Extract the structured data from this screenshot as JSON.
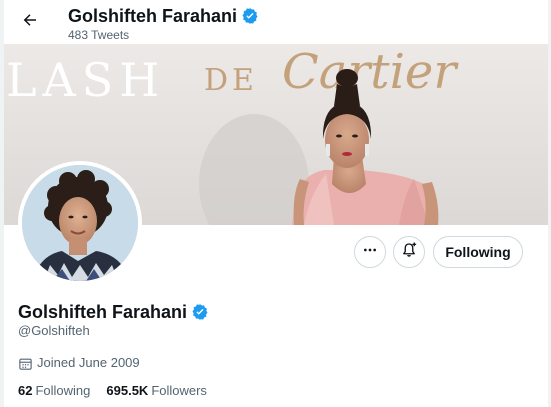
{
  "header": {
    "name": "Golshifteh Farahani",
    "tweets_count": "483 Tweets",
    "back_icon": "arrow-left-icon"
  },
  "banner": {
    "sign_text_left": "LASH",
    "sign_text_de": "DE",
    "sign_text_brand": "Cartier"
  },
  "actions": {
    "more_icon": "ellipsis-icon",
    "notify_icon": "bell-plus-icon",
    "following_label": "Following"
  },
  "profile": {
    "name": "Golshifteh Farahani",
    "handle": "@Golshifteh",
    "joined": "Joined June 2009",
    "following_count": "62",
    "following_label": "Following",
    "followers_count": "695.5K",
    "followers_label": "Followers"
  },
  "colors": {
    "verified": "#1d9bf0",
    "text_primary": "#0f1419",
    "text_secondary": "#536471",
    "border": "#cfd9de"
  }
}
